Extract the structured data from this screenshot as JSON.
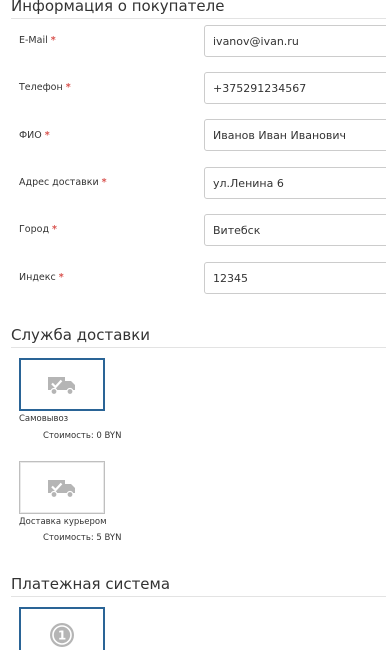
{
  "buyer_section": {
    "title": "Информация о покупателе"
  },
  "required_mark": "*",
  "fields": [
    {
      "label": "E-Mail",
      "value": "ivanov@ivan.ru"
    },
    {
      "label": "Телефон",
      "value": "+375291234567"
    },
    {
      "label": "ФИО",
      "value": "Иванов Иван Иванович"
    },
    {
      "label": "Адрес доставки",
      "value": "ул.Ленина 6"
    },
    {
      "label": "Город",
      "value": "Витебск"
    },
    {
      "label": "Индекс",
      "value": "12345"
    }
  ],
  "delivery_section": {
    "title": "Служба доставки",
    "options": [
      {
        "name": "Самовывоз",
        "cost": "Стоимость: 0 BYN",
        "selected": true,
        "icon": "truck-check-icon"
      },
      {
        "name": "Доставка курьером",
        "cost": "Стоимость: 5 BYN",
        "selected": false,
        "icon": "truck-check-icon"
      }
    ]
  },
  "payment_section": {
    "title": "Платежная система",
    "options": [
      {
        "icon": "coin-one-icon",
        "icon_text": "1",
        "selected": true
      }
    ]
  },
  "colors": {
    "required": "#d9534f",
    "selected_border": "#2a6496",
    "icon_gray": "#b5b5b5"
  }
}
